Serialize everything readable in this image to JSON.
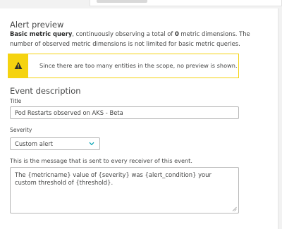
{
  "preview": {
    "heading": "Alert preview",
    "intro_bold": "Basic metric query",
    "intro_text_a": ", continuously observing a total of ",
    "intro_count": "0",
    "intro_text_b": " metric dimensions. The number of observed metric dimensions is not limited for basic metric queries.",
    "warning": "Since there are too many entities in the scope, no preview is shown.",
    "warning_icon": "warning-triangle-icon",
    "warning_color": "#f5d30f"
  },
  "event": {
    "heading": "Event description",
    "title_label": "Title",
    "title_value": "Pod Restarts observed on AKS - Beta",
    "severity_label": "Severity",
    "severity_value": "Custom alert",
    "message_help": "This is the message that is sent to every receiver of this event.",
    "message_value": "The {metricname} value of {severity} was {alert_condition} your custom threshold of {threshold}."
  }
}
